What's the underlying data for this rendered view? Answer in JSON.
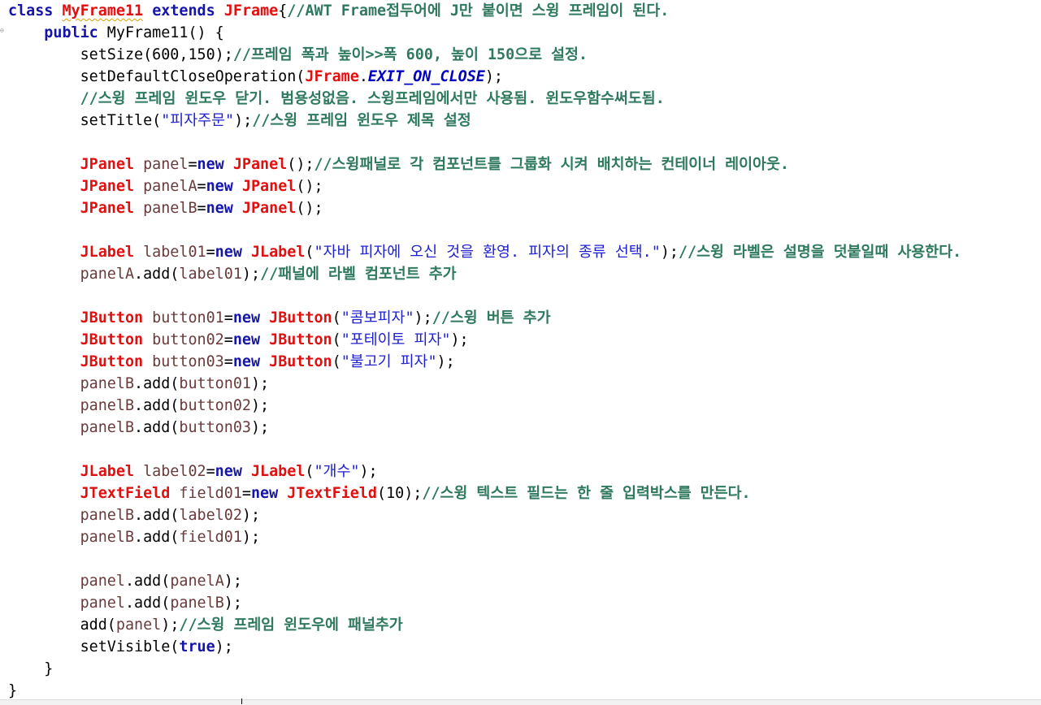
{
  "editor": {
    "language": "java",
    "colors": {
      "keyword": "#1515aa",
      "type": "#e01010",
      "comment": "#2f7a5f",
      "string": "#2020d0",
      "variable": "#6a3b3b",
      "constant": "#0000c0",
      "background": "#ffffff"
    },
    "lines": [
      {
        "indent": 0,
        "tokens": [
          {
            "c": "kw",
            "t": "class"
          },
          {
            "c": "pl",
            "t": " "
          },
          {
            "c": "ty squiggle",
            "t": "MyFrame11"
          },
          {
            "c": "pl",
            "t": " "
          },
          {
            "c": "kw",
            "t": "extends"
          },
          {
            "c": "pl",
            "t": " "
          },
          {
            "c": "ty",
            "t": "JFrame"
          },
          {
            "c": "pl",
            "t": "{"
          },
          {
            "c": "cm",
            "t": "//AWT Frame접두어에 J만 붙이면 스윙 프레임이 된다."
          }
        ]
      },
      {
        "indent": 4,
        "tokens": [
          {
            "c": "kw",
            "t": "public"
          },
          {
            "c": "pl",
            "t": " MyFrame11() {"
          }
        ]
      },
      {
        "indent": 8,
        "tokens": [
          {
            "c": "pl",
            "t": "setSize(600,150);"
          },
          {
            "c": "cm",
            "t": "//프레임 폭과 높이>>폭 600, 높이 150으로 설정."
          }
        ]
      },
      {
        "indent": 8,
        "tokens": [
          {
            "c": "pl",
            "t": "setDefaultCloseOperation("
          },
          {
            "c": "ty",
            "t": "JFrame"
          },
          {
            "c": "pl",
            "t": "."
          },
          {
            "c": "ct",
            "t": "EXIT_ON_CLOSE"
          },
          {
            "c": "pl",
            "t": ");"
          }
        ]
      },
      {
        "indent": 8,
        "tokens": [
          {
            "c": "cm",
            "t": "//스윙 프레임 윈도우 닫기. 범용성없음. 스윙프레임에서만 사용됨. 윈도우함수써도됨."
          }
        ]
      },
      {
        "indent": 8,
        "tokens": [
          {
            "c": "pl",
            "t": "setTitle("
          },
          {
            "c": "st",
            "t": "\"피자주문\""
          },
          {
            "c": "pl",
            "t": ");"
          },
          {
            "c": "cm",
            "t": "//스윙 프레임 윈도우 제목 설정"
          }
        ]
      },
      {
        "indent": 0,
        "tokens": []
      },
      {
        "indent": 8,
        "tokens": [
          {
            "c": "ty",
            "t": "JPanel"
          },
          {
            "c": "va",
            "t": " panel"
          },
          {
            "c": "pl",
            "t": "="
          },
          {
            "c": "kw",
            "t": "new"
          },
          {
            "c": "pl",
            "t": " "
          },
          {
            "c": "ty",
            "t": "JPanel"
          },
          {
            "c": "pl",
            "t": "();"
          },
          {
            "c": "cm",
            "t": "//스윙패널로 각 컴포넌트를 그룹화 시켜 배치하는 컨테이너 레이아웃."
          }
        ]
      },
      {
        "indent": 8,
        "tokens": [
          {
            "c": "ty",
            "t": "JPanel"
          },
          {
            "c": "va",
            "t": " panelA"
          },
          {
            "c": "pl",
            "t": "="
          },
          {
            "c": "kw",
            "t": "new"
          },
          {
            "c": "pl",
            "t": " "
          },
          {
            "c": "ty",
            "t": "JPanel"
          },
          {
            "c": "pl",
            "t": "();"
          }
        ]
      },
      {
        "indent": 8,
        "tokens": [
          {
            "c": "ty",
            "t": "JPanel"
          },
          {
            "c": "va",
            "t": " panelB"
          },
          {
            "c": "pl",
            "t": "="
          },
          {
            "c": "kw",
            "t": "new"
          },
          {
            "c": "pl",
            "t": " "
          },
          {
            "c": "ty",
            "t": "JPanel"
          },
          {
            "c": "pl",
            "t": "();"
          }
        ]
      },
      {
        "indent": 0,
        "tokens": []
      },
      {
        "indent": 8,
        "tokens": [
          {
            "c": "ty",
            "t": "JLabel"
          },
          {
            "c": "va",
            "t": " label01"
          },
          {
            "c": "pl",
            "t": "="
          },
          {
            "c": "kw",
            "t": "new"
          },
          {
            "c": "pl",
            "t": " "
          },
          {
            "c": "ty",
            "t": "JLabel"
          },
          {
            "c": "pl",
            "t": "("
          },
          {
            "c": "st",
            "t": "\"자바 피자에 오신 것을 환영. 피자의 종류 선택.\""
          },
          {
            "c": "pl",
            "t": ");"
          },
          {
            "c": "cm",
            "t": "//스윙 라벨은 설명을 덧붙일때 사용한다."
          }
        ]
      },
      {
        "indent": 8,
        "tokens": [
          {
            "c": "va",
            "t": "panelA"
          },
          {
            "c": "pl",
            "t": ".add("
          },
          {
            "c": "va",
            "t": "label01"
          },
          {
            "c": "pl",
            "t": ");"
          },
          {
            "c": "cm",
            "t": "//패널에 라벨 컴포넌트 추가"
          }
        ]
      },
      {
        "indent": 0,
        "tokens": []
      },
      {
        "indent": 8,
        "tokens": [
          {
            "c": "ty",
            "t": "JButton"
          },
          {
            "c": "va",
            "t": " button01"
          },
          {
            "c": "pl",
            "t": "="
          },
          {
            "c": "kw",
            "t": "new"
          },
          {
            "c": "pl",
            "t": " "
          },
          {
            "c": "ty",
            "t": "JButton"
          },
          {
            "c": "pl",
            "t": "("
          },
          {
            "c": "st",
            "t": "\"콤보피자\""
          },
          {
            "c": "pl",
            "t": ");"
          },
          {
            "c": "cm",
            "t": "//스윙 버튼 추가"
          }
        ]
      },
      {
        "indent": 8,
        "tokens": [
          {
            "c": "ty",
            "t": "JButton"
          },
          {
            "c": "va",
            "t": " button02"
          },
          {
            "c": "pl",
            "t": "="
          },
          {
            "c": "kw",
            "t": "new"
          },
          {
            "c": "pl",
            "t": " "
          },
          {
            "c": "ty",
            "t": "JButton"
          },
          {
            "c": "pl",
            "t": "("
          },
          {
            "c": "st",
            "t": "\"포테이토 피자\""
          },
          {
            "c": "pl",
            "t": ");"
          }
        ]
      },
      {
        "indent": 8,
        "tokens": [
          {
            "c": "ty",
            "t": "JButton"
          },
          {
            "c": "va",
            "t": " button03"
          },
          {
            "c": "pl",
            "t": "="
          },
          {
            "c": "kw",
            "t": "new"
          },
          {
            "c": "pl",
            "t": " "
          },
          {
            "c": "ty",
            "t": "JButton"
          },
          {
            "c": "pl",
            "t": "("
          },
          {
            "c": "st",
            "t": "\"불고기 피자\""
          },
          {
            "c": "pl",
            "t": ");"
          }
        ]
      },
      {
        "indent": 8,
        "tokens": [
          {
            "c": "va",
            "t": "panelB"
          },
          {
            "c": "pl",
            "t": ".add("
          },
          {
            "c": "va",
            "t": "button01"
          },
          {
            "c": "pl",
            "t": ");"
          }
        ]
      },
      {
        "indent": 8,
        "tokens": [
          {
            "c": "va",
            "t": "panelB"
          },
          {
            "c": "pl",
            "t": ".add("
          },
          {
            "c": "va",
            "t": "button02"
          },
          {
            "c": "pl",
            "t": ");"
          }
        ]
      },
      {
        "indent": 8,
        "tokens": [
          {
            "c": "va",
            "t": "panelB"
          },
          {
            "c": "pl",
            "t": ".add("
          },
          {
            "c": "va",
            "t": "button03"
          },
          {
            "c": "pl",
            "t": ");"
          }
        ]
      },
      {
        "indent": 0,
        "tokens": []
      },
      {
        "indent": 8,
        "tokens": [
          {
            "c": "ty",
            "t": "JLabel"
          },
          {
            "c": "va",
            "t": " label02"
          },
          {
            "c": "pl",
            "t": "="
          },
          {
            "c": "kw",
            "t": "new"
          },
          {
            "c": "pl",
            "t": " "
          },
          {
            "c": "ty",
            "t": "JLabel"
          },
          {
            "c": "pl",
            "t": "("
          },
          {
            "c": "st",
            "t": "\"개수\""
          },
          {
            "c": "pl",
            "t": ");"
          }
        ]
      },
      {
        "indent": 8,
        "tokens": [
          {
            "c": "ty",
            "t": "JTextField"
          },
          {
            "c": "va",
            "t": " field01"
          },
          {
            "c": "pl",
            "t": "="
          },
          {
            "c": "kw",
            "t": "new"
          },
          {
            "c": "pl",
            "t": " "
          },
          {
            "c": "ty",
            "t": "JTextField"
          },
          {
            "c": "pl",
            "t": "(10);"
          },
          {
            "c": "cm",
            "t": "//스윙 텍스트 필드는 한 줄 입력박스를 만든다."
          }
        ]
      },
      {
        "indent": 8,
        "tokens": [
          {
            "c": "va",
            "t": "panelB"
          },
          {
            "c": "pl",
            "t": ".add("
          },
          {
            "c": "va",
            "t": "label02"
          },
          {
            "c": "pl",
            "t": ");"
          }
        ]
      },
      {
        "indent": 8,
        "tokens": [
          {
            "c": "va",
            "t": "panelB"
          },
          {
            "c": "pl",
            "t": ".add("
          },
          {
            "c": "va",
            "t": "field01"
          },
          {
            "c": "pl",
            "t": ");"
          }
        ]
      },
      {
        "indent": 0,
        "tokens": []
      },
      {
        "indent": 8,
        "tokens": [
          {
            "c": "va",
            "t": "panel"
          },
          {
            "c": "pl",
            "t": ".add("
          },
          {
            "c": "va",
            "t": "panelA"
          },
          {
            "c": "pl",
            "t": ");"
          }
        ]
      },
      {
        "indent": 8,
        "tokens": [
          {
            "c": "va",
            "t": "panel"
          },
          {
            "c": "pl",
            "t": ".add("
          },
          {
            "c": "va",
            "t": "panelB"
          },
          {
            "c": "pl",
            "t": ");"
          }
        ]
      },
      {
        "indent": 8,
        "tokens": [
          {
            "c": "pl",
            "t": "add("
          },
          {
            "c": "va",
            "t": "panel"
          },
          {
            "c": "pl",
            "t": ");"
          },
          {
            "c": "cm",
            "t": "//스윙 프레임 윈도우에 패널추가"
          }
        ]
      },
      {
        "indent": 8,
        "tokens": [
          {
            "c": "pl",
            "t": "setVisible("
          },
          {
            "c": "kw",
            "t": "true"
          },
          {
            "c": "pl",
            "t": ");"
          }
        ]
      },
      {
        "indent": 4,
        "tokens": [
          {
            "c": "pl",
            "t": "}"
          }
        ]
      },
      {
        "indent": 0,
        "tokens": [
          {
            "c": "pl",
            "t": "}"
          }
        ]
      }
    ]
  }
}
